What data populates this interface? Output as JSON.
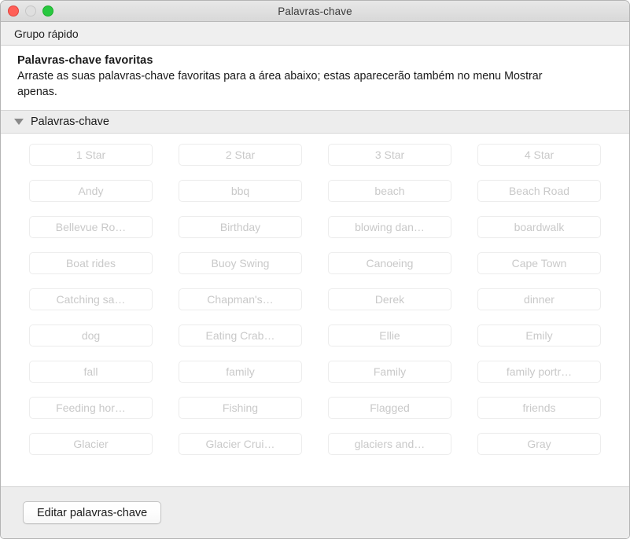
{
  "window": {
    "title": "Palavras-chave",
    "traffic_lights": [
      {
        "name": "close-button",
        "color": "#ff5f57"
      },
      {
        "name": "minimize-button",
        "color": "#dfdfdf"
      },
      {
        "name": "zoom-button",
        "color": "#28c840"
      }
    ]
  },
  "toolbar": {
    "label": "Grupo rápido"
  },
  "description": {
    "heading": "Palavras-chave favoritas",
    "body": "Arraste as suas palavras-chave favoritas para a área abaixo; estas aparecerão também no menu Mostrar apenas."
  },
  "section": {
    "title": "Palavras-chave",
    "disclosure_icon": "triangle-down-icon",
    "expanded": true
  },
  "keywords": [
    "1 Star",
    "2 Star",
    "3 Star",
    "4 Star",
    "Andy",
    "bbq",
    "beach",
    "Beach Road",
    "Bellevue Ro…",
    "Birthday",
    "blowing dan…",
    "boardwalk",
    "Boat rides",
    "Buoy Swing",
    "Canoeing",
    "Cape Town",
    "Catching sa…",
    "Chapman's…",
    "Derek",
    "dinner",
    "dog",
    "Eating Crab…",
    "Ellie",
    "Emily",
    "fall",
    "family",
    "Family",
    "family portr…",
    "Feeding hor…",
    "Fishing",
    "Flagged",
    "friends",
    "Glacier",
    "Glacier Crui…",
    "glaciers and…",
    "Gray"
  ],
  "footer": {
    "edit_button_label": "Editar palavras-chave"
  },
  "colors": {
    "titlebar_top": "#e8e8e8",
    "titlebar_bottom": "#d8d8d8",
    "toolbar_bg": "#efefef",
    "section_bg": "#ededed",
    "token_border": "#ededed",
    "token_text": "#c9c9c9",
    "body_text": "#1b1b1b"
  }
}
